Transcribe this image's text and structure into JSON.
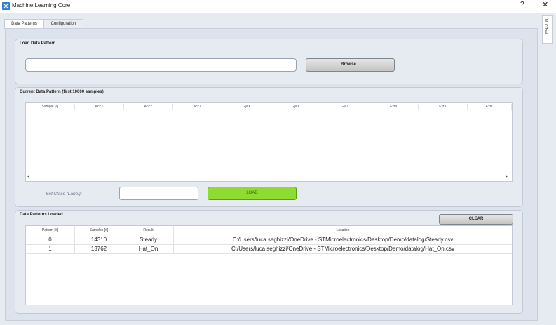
{
  "window": {
    "title": "Machine Learning Core",
    "help_glyph": "?",
    "close_glyph": "✕"
  },
  "tabs": [
    {
      "label": "Data Patterns"
    },
    {
      "label": "Configuration"
    }
  ],
  "side_tab": {
    "label": "MLC Tool"
  },
  "load_pattern": {
    "title": "Load Data Pattern",
    "path_value": "",
    "browse_label": "Browse..."
  },
  "current_pattern": {
    "title": "Current Data Pattern (first 10000 samples)",
    "columns": [
      "Sample [#]",
      "AccX",
      "AccY",
      "AccZ",
      "GyrX",
      "GyrY",
      "GyrZ",
      "ExtX",
      "ExtY",
      "ExtZ"
    ],
    "scroll_left": "◂",
    "scroll_right": "▸",
    "class_label": "Set Class (Label):",
    "class_value": "",
    "load_label": "LOAD"
  },
  "loaded_patterns": {
    "title": "Data Patterns Loaded",
    "clear_label": "CLEAR",
    "headers": [
      "Pattern [#]",
      "Samples [#]",
      "Result",
      "Location"
    ],
    "rows": [
      {
        "pattern": "0",
        "samples": "14310",
        "result": "Steady",
        "location": "C:/Users/luca seghizzi/OneDrive - STMicroelectronics/Desktop/Demo/datalog/Steady.csv"
      },
      {
        "pattern": "1",
        "samples": "13762",
        "result": "Hat_On",
        "location": "C:/Users/luca seghizzi/OneDrive - STMicroelectronics/Desktop/Demo/datalog/Hat_On.csv"
      }
    ]
  },
  "colors": {
    "load_button": "#8fdc31",
    "window_bg": "#e6eaf1"
  }
}
